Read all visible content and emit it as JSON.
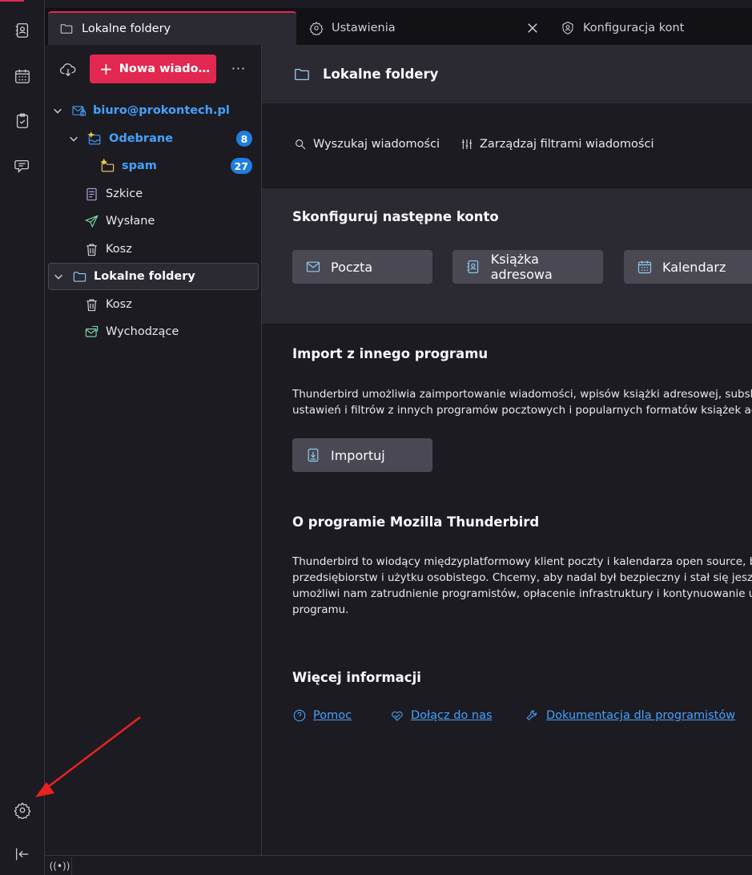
{
  "tabs": [
    {
      "label": "Lokalne foldery",
      "icon": "folder-icon"
    },
    {
      "label": "Ustawienia",
      "icon": "gear-icon"
    },
    {
      "label": "Konfiguracja kont",
      "icon": "account-icon"
    }
  ],
  "spaces": [
    "address-book-icon",
    "calendar-icon",
    "tasks-icon",
    "chat-icon",
    "settings-icon",
    "collapse-icon"
  ],
  "folder_pane": {
    "new_message_label": "Nowa wiado…",
    "more_label": "···",
    "folders": [
      {
        "label": "biuro@prokontech.pl",
        "icon": "mail-account-icon"
      },
      {
        "label": "Odebrane",
        "icon": "inbox-icon",
        "badge": "8"
      },
      {
        "label": "spam",
        "icon": "folder-new-icon",
        "badge": "27"
      },
      {
        "label": "Szkice",
        "icon": "drafts-icon"
      },
      {
        "label": "Wysłane",
        "icon": "sent-icon"
      },
      {
        "label": "Kosz",
        "icon": "trash-icon"
      },
      {
        "label": "Lokalne foldery",
        "icon": "folder-icon"
      },
      {
        "label": "Kosz",
        "icon": "trash-icon"
      },
      {
        "label": "Wychodzące",
        "icon": "outbox-icon"
      }
    ]
  },
  "main": {
    "header_title": "Lokalne foldery",
    "search_label": "Wyszukaj wiadomości",
    "filters_label": "Zarządzaj filtrami wiadomości",
    "setup_title": "Skonfiguruj następne konto",
    "setup_buttons": [
      "Poczta",
      "Książka adresowa",
      "Kalendarz"
    ],
    "import_title": "Import z innego programu",
    "import_text": [
      "Thunderbird umożliwia zaimportowanie wiadomości, wpisów książki adresowej, subskry",
      "ustawień i filtrów z innych programów pocztowych i popularnych formatów książek adr"
    ],
    "import_button": "Importuj",
    "about_title": "O programie Mozilla Thunderbird",
    "about_text": [
      "Thunderbird to wiodący międzyplatformowy klient poczty i kalendarza open source, be",
      "przedsiębiorstw i użytku osobistego. Chcemy, aby nadal był bezpieczny i stał się jeszcze",
      "umożliwi nam zatrudnienie programistów, opłacenie infrastruktury i kontynuowanie ule",
      "programu."
    ],
    "more_info_title": "Więcej informacji",
    "links": [
      "Pomoc",
      "Dołącz do nas",
      "Dokumentacja dla programistów"
    ]
  },
  "statusbar": {
    "network_label": "((•))"
  },
  "colors": {
    "accent": "#e22850",
    "link": "#45a1ff",
    "badge": "#1f7ee0",
    "arrow": "#e8231d"
  }
}
